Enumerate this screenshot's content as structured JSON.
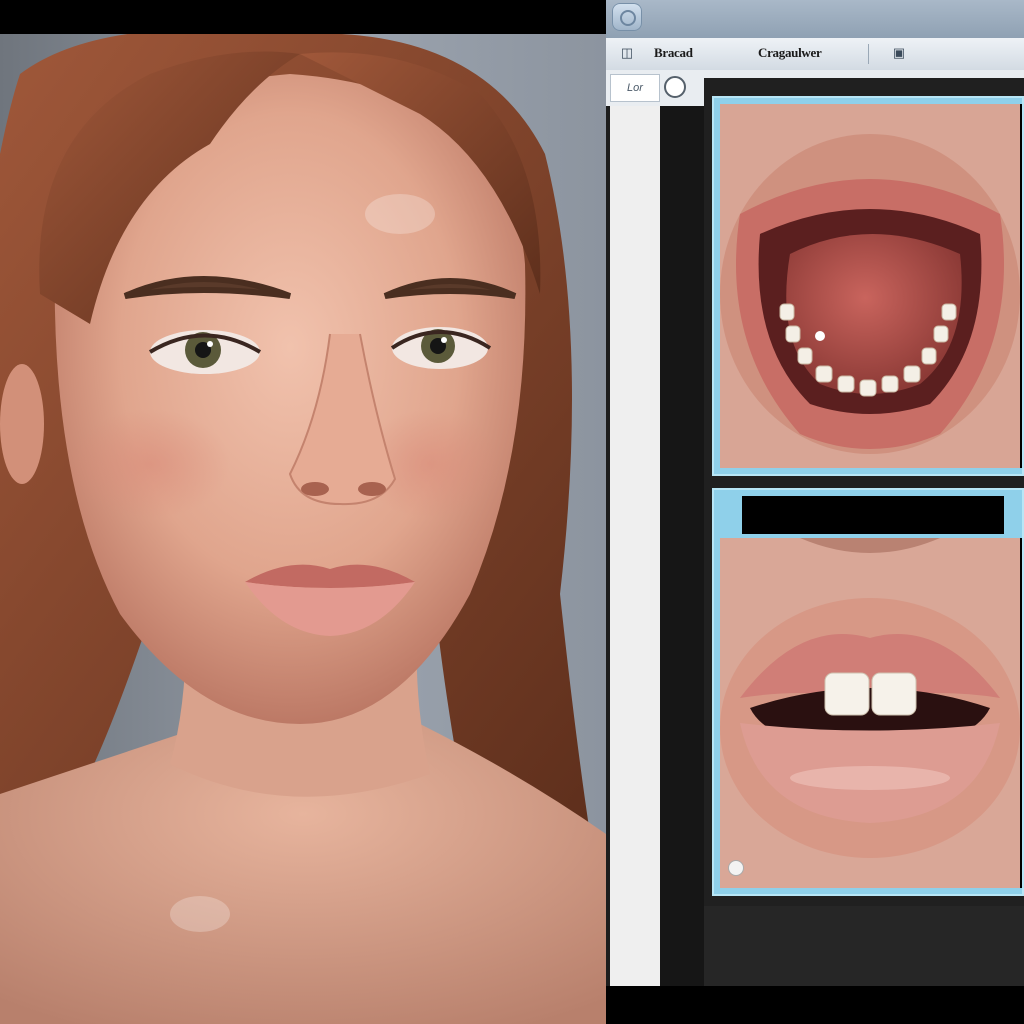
{
  "window": {
    "menu": {
      "item_1_label": "Bracad",
      "item_2_label": "Cragaulwer"
    },
    "toolbar": {
      "tab_label": "Lor"
    }
  },
  "colors": {
    "panel_border": "#8fd0ea",
    "titlebar": "#a9b8c8",
    "menubar": "#e2e8ee",
    "skin": "#e3aa93",
    "hair": "#8a4a2c",
    "background_gray": "#8e97a2"
  },
  "icons": {
    "app": "app-logo-icon",
    "menu_left": "camera-icon",
    "menu_right": "window-icon",
    "toolbar": "circle-tool-icon",
    "panel_marker": "marker-dot-icon"
  }
}
